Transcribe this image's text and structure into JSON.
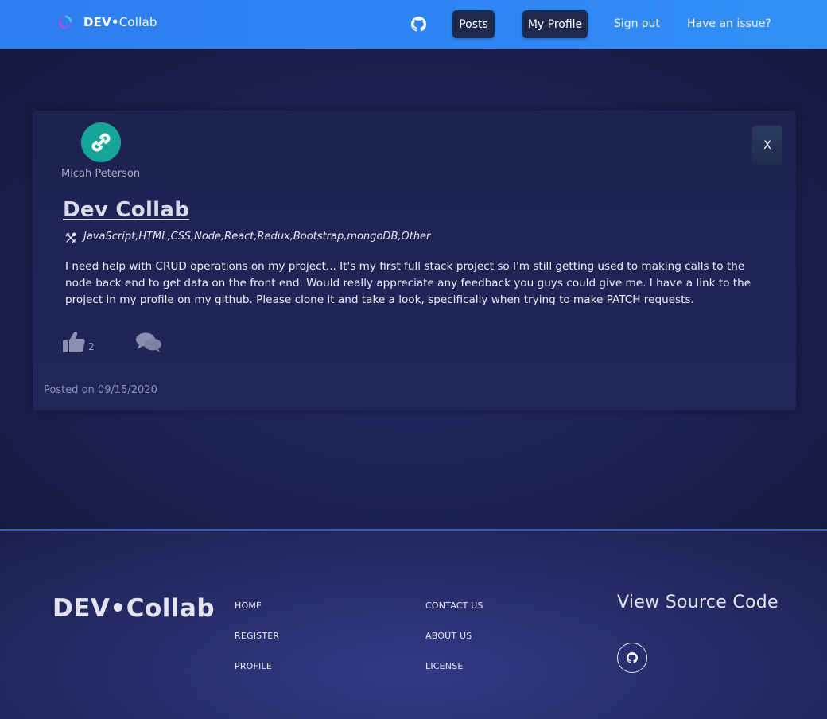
{
  "navbar": {
    "brand_bold": "DEV",
    "brand_dot": "•",
    "brand_rest": "Collab",
    "github_icon": "github-icon",
    "posts_label": "Posts",
    "profile_label": "My Profile",
    "signout_label": "Sign out",
    "issue_label": "Have an issue?"
  },
  "post": {
    "author": "Micah Peterson",
    "close_label": "X",
    "title": "Dev Collab",
    "technologies": "JavaScript,HTML,CSS,Node,React,Redux,Bootstrap,mongoDB,Other",
    "body": "I need help with CRUD operations on my project... It's my first full stack project so I'm still getting used to making calls to the node back end to get data on the front end. Would really appreciate any feedback you guys could give me. I have a link to the project in my profile on my github. Please clone it and take a look, specifically when trying to make PATCH requests.",
    "likes": "2",
    "posted_prefix": "Posted on",
    "posted_date": "09/15/2020"
  },
  "footer": {
    "brand": "DEV•Collab",
    "links_col1": [
      "HOME",
      "REGISTER",
      "PROFILE"
    ],
    "links_col2": [
      "CONTACT US",
      "ABOUT US",
      "LICENSE"
    ],
    "source_title": "View Source Code"
  },
  "colors": {
    "navbar": "#2f86f4",
    "page_bg": "#1d2052",
    "card_bg": "#1e2250",
    "avatar": "#17a59a",
    "button_dark": "#1f2a4a"
  }
}
